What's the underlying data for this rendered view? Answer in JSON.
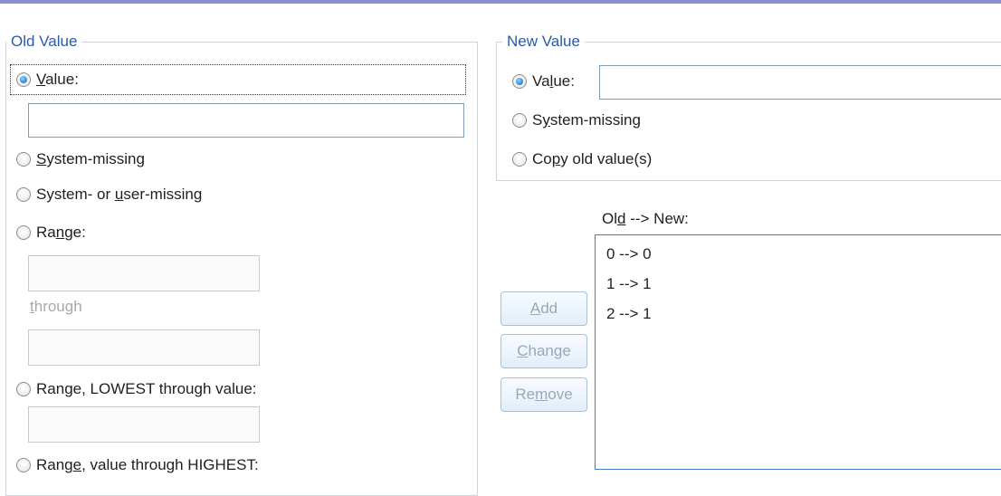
{
  "old_value": {
    "legend": "Old Value",
    "value_radio": {
      "pre": "",
      "u": "V",
      "post": "alue:",
      "selected": true
    },
    "value_input": "",
    "system_missing": {
      "pre": "",
      "u": "S",
      "post": "ystem-missing"
    },
    "system_or_user_missing": {
      "pre": "System- or ",
      "u": "u",
      "post": "ser-missing"
    },
    "range": {
      "pre": "Ra",
      "u": "n",
      "post": "ge:"
    },
    "through": {
      "pre": "",
      "u": "t",
      "post": "hrough"
    },
    "range_lowest": {
      "pre": "Ran",
      "u": "g",
      "post": "e, LOWEST through value:"
    },
    "range_highest": {
      "pre": "Rang",
      "u": "e",
      "post": ", value through HIGHEST:"
    }
  },
  "new_value": {
    "legend": "New Value",
    "value_radio": {
      "pre": "Va",
      "u": "l",
      "post": "ue:",
      "selected": true
    },
    "value_input": "",
    "system_missing": {
      "pre": "S",
      "u": "y",
      "post": "stem-missing"
    },
    "copy_old": {
      "pre": "Co",
      "u": "p",
      "post": "y old value(s)"
    }
  },
  "mapping": {
    "label": {
      "pre": "Ol",
      "u": "d",
      "post": " --> New:"
    },
    "items": [
      "0 --> 0",
      "1 --> 1",
      "2 --> 1"
    ]
  },
  "buttons": {
    "add": {
      "pre": "",
      "u": "A",
      "post": "dd"
    },
    "change": {
      "pre": "",
      "u": "C",
      "post": "hange"
    },
    "remove": {
      "pre": "Re",
      "u": "m",
      "post": "ove"
    }
  },
  "colors": {
    "accent": "#2a5aa8",
    "top_bar": "#8a8fd2",
    "list_border": "#3e7cc6"
  }
}
